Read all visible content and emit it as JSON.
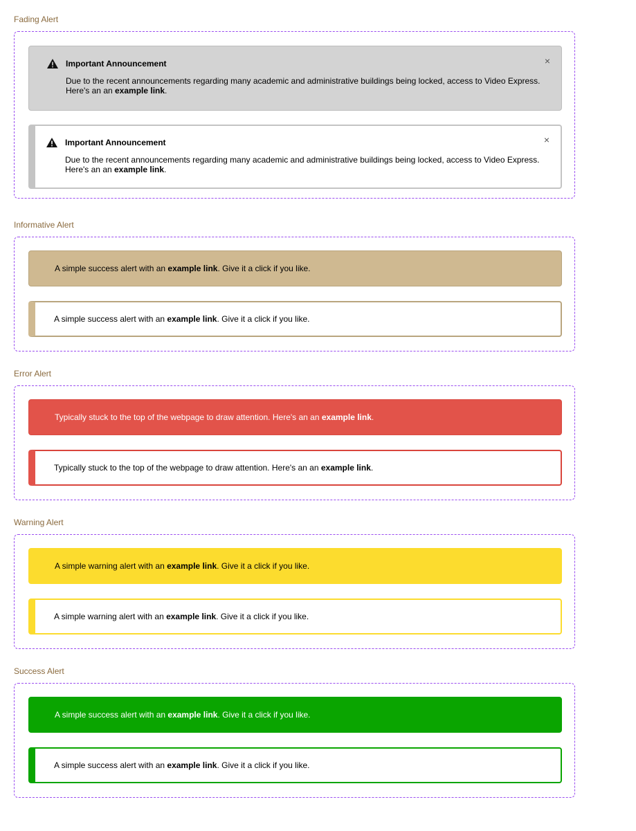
{
  "sections": {
    "fading": {
      "label": "Fading Alert",
      "alerts": [
        {
          "title": "Important Announcement",
          "body_text": "Due to the recent announcements regarding many academic and administrative buildings being locked, access to Video Express.",
          "body_line2": "Here's an an ",
          "link": "example link",
          "suffix": ".",
          "close": "×"
        },
        {
          "title": "Important Announcement",
          "body_text": "Due to the recent announcements regarding many academic and administrative buildings being locked, access to Video Express.",
          "body_line2": "Here's an an ",
          "link": "example link",
          "suffix": ".",
          "close": "×"
        }
      ]
    },
    "informative": {
      "label": "Informative Alert",
      "prefix": "A simple success alert with an ",
      "link": "example link",
      "suffix": ". Give it a click if you like."
    },
    "error": {
      "label": "Error Alert",
      "prefix": "Typically stuck to the top of the webpage to draw attention. Here's an an ",
      "link": "example link",
      "suffix": "."
    },
    "warning": {
      "label": "Warning Alert",
      "prefix": "A simple warning alert with an ",
      "link": "example link",
      "suffix": ". Give it a click if you like."
    },
    "success": {
      "label": "Success Alert",
      "prefix": "A simple success alert with an ",
      "link": "example link",
      "suffix": ". Give it a click if you like."
    }
  },
  "colors": {
    "section_label": "#8a6a3e",
    "group_border": "#9a4cf0",
    "fading_bg": "#d3d3d3",
    "informative": "#cfb991",
    "error": "#e2534a",
    "warning": "#fcdc2e",
    "success": "#0aa500"
  },
  "icons": {
    "warning": "warning-triangle-icon",
    "close": "close-icon"
  }
}
